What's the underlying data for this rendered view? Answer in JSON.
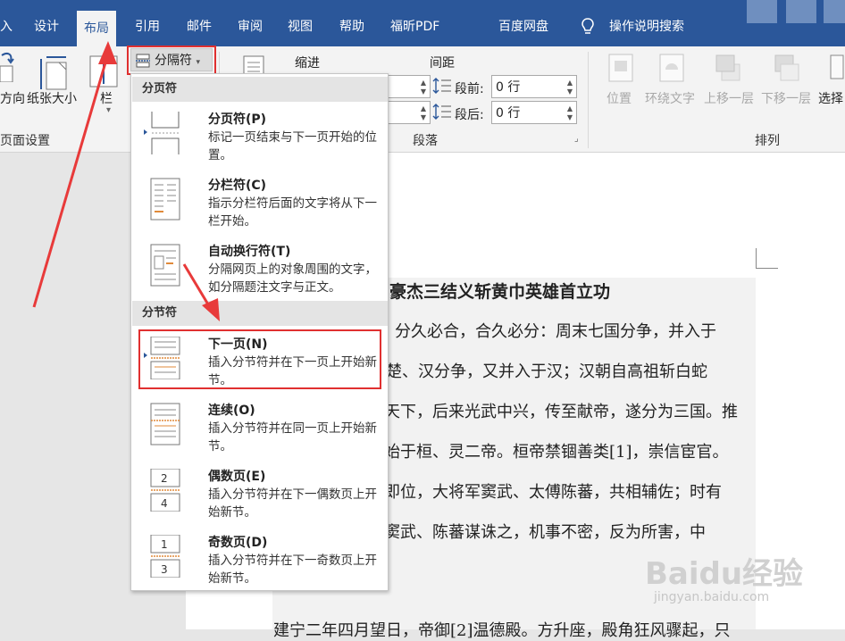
{
  "ribbon_tabs": [
    "入",
    "设计",
    "布局",
    "引用",
    "邮件",
    "审阅",
    "视图",
    "帮助",
    "福昕PDF",
    "百度网盘"
  ],
  "active_tab": "布局",
  "tell_me": "操作说明搜索",
  "ribbon": {
    "orientation_label": "方向",
    "size_label": "纸张大小",
    "columns_label": "栏",
    "page_setup_group": "页面设置",
    "breaks_button": "分隔符",
    "indent_label": "缩进",
    "spacing_label": "间距",
    "before_label": "段前:",
    "before_value": "0 行",
    "after_label": "段后:",
    "after_value": "0 行",
    "paragraph_group": "段落",
    "position_label": "位置",
    "wrap_text_label": "环绕文字",
    "bring_forward_label": "上移一层",
    "send_backward_label": "下移一层",
    "select_label": "选择",
    "arrange_group": "排列"
  },
  "breaks_menu": {
    "page_breaks_header": "分页符",
    "section_breaks_header": "分节符",
    "items": [
      {
        "title": "分页符(P)",
        "desc": "标记一页结束与下一页开始的位置。"
      },
      {
        "title": "分栏符(C)",
        "desc": "指示分栏符后面的文字将从下一栏开始。"
      },
      {
        "title": "自动换行符(T)",
        "desc": "分隔网页上的对象周围的文字，如分隔题注文字与正文。"
      },
      {
        "title": "下一页(N)",
        "desc": "插入分节符并在下一页上开始新节。"
      },
      {
        "title": "连续(O)",
        "desc": "插入分节符并在同一页上开始新节。"
      },
      {
        "title": "偶数页(E)",
        "desc": "插入分节符并在下一偶数页上开始新节。"
      },
      {
        "title": "奇数页(D)",
        "desc": "插入分节符并在下一奇数页上开始新节。"
      }
    ]
  },
  "document": {
    "title": "豪杰三结义斩黄巾英雄首立功",
    "lines": [
      "分久必合，合久必分：周末七国分争，并入于",
      "楚、汉分争，又并入于汉；汉朝自高祖斩白蛇",
      "天下，后来光武中兴，传至献帝，遂分为三国。推",
      "始于桓、灵二帝。桓帝禁锢善类[1]，崇信宦官。",
      "即位，大将军窦武、太傅陈蕃，共相辅佐；时有",
      "窦武、陈蕃谋诛之，机事不密，反为所害，中",
      "建宁二年四月望日，帝御[2]温德殿。方升座，殿角狂风骤起，只"
    ]
  },
  "watermark": {
    "logo": "Baidu经验",
    "url": "jingyan.baidu.com"
  }
}
